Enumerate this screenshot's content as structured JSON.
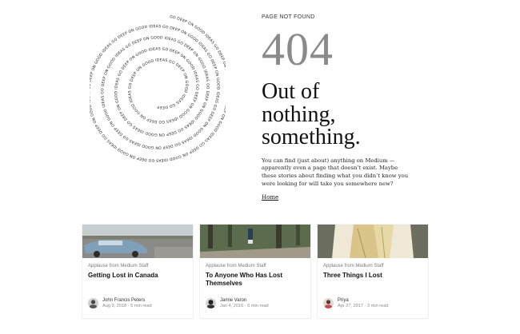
{
  "hero": {
    "eyebrow": "PAGE NOT FOUND",
    "code": "404",
    "headline": [
      "Out of",
      "nothing,",
      "something."
    ],
    "description": "You can find (just about) anything on Medium — apparently even a page that doesn’t exist. Maybe these stories about finding what you didn’t know you were looking for will take you somewhere new?",
    "home_link": "Home"
  },
  "illustration": {
    "spiral_text": "GO DEEP ON GOOD IDEAS"
  },
  "cards": [
    {
      "kicker": "Applause from Medium Staff",
      "title": "Getting Lost in Canada",
      "author": "John Francis Peters",
      "date": "Aug 9, 2018",
      "read_time": "5 min read"
    },
    {
      "kicker": "Applause from Medium Staff",
      "title": "To Anyone Who Has Lost Themselves",
      "author": "Jamie Varon",
      "date": "Jan 4, 2016",
      "read_time": "6 min read"
    },
    {
      "kicker": "Applause from Medium Staff",
      "title": "Three Things I Lost",
      "author": "Priya",
      "date": "Apr 27, 2017",
      "read_time": "3 min read"
    }
  ]
}
